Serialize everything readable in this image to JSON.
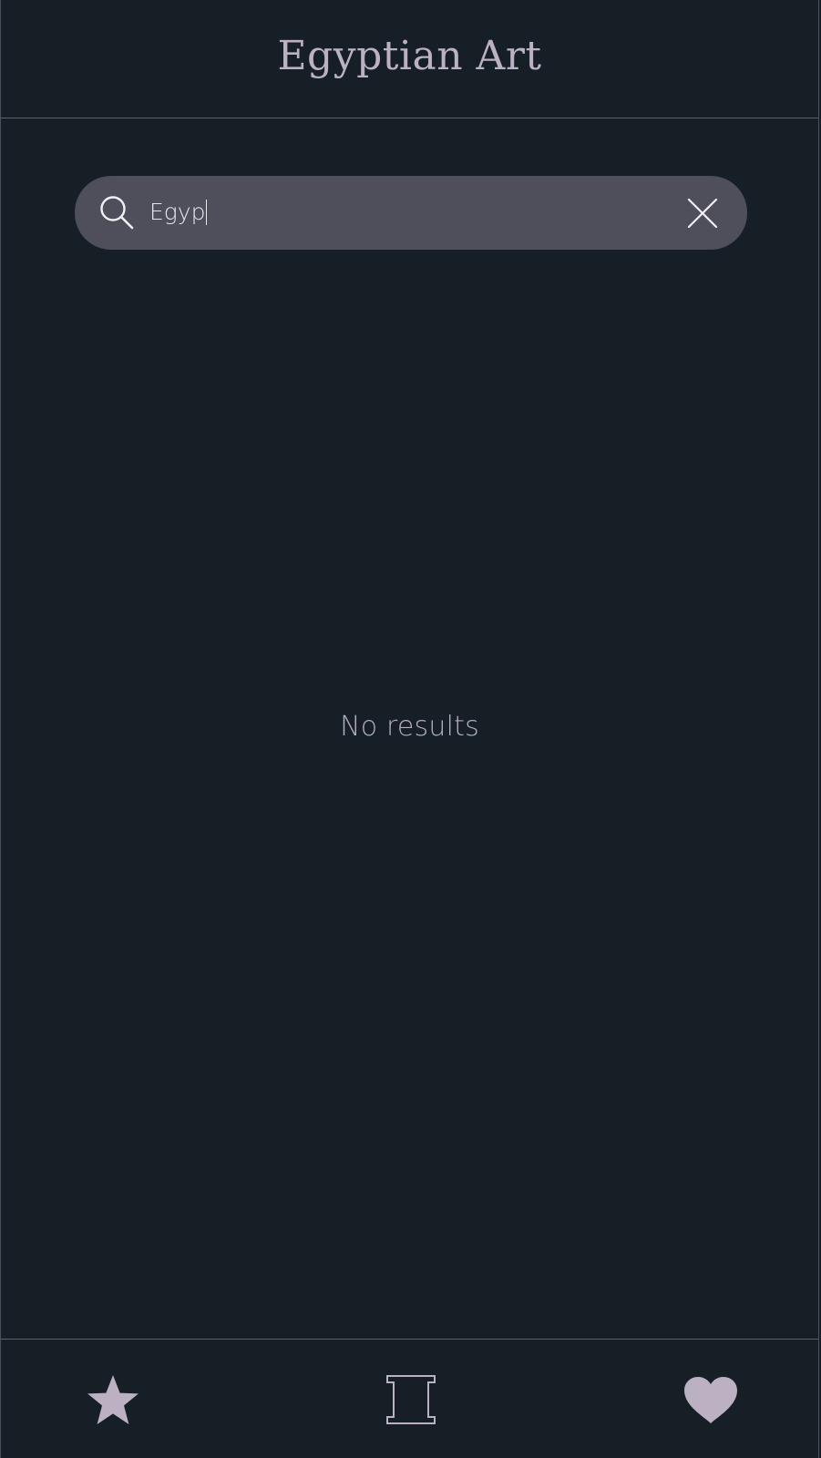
{
  "header": {
    "title": "Egyptian Art"
  },
  "search": {
    "value": "Egyp",
    "search_icon": "search-icon",
    "clear_icon": "close-icon"
  },
  "main": {
    "empty_message": "No results"
  },
  "bottom_nav": {
    "items": [
      {
        "icon": "star-icon"
      },
      {
        "icon": "column-icon"
      },
      {
        "icon": "heart-icon"
      }
    ]
  },
  "colors": {
    "background": "#171f26",
    "accent": "#bcb0c3",
    "search_bar": "#4f4e5b",
    "divider": "#5c6068"
  }
}
